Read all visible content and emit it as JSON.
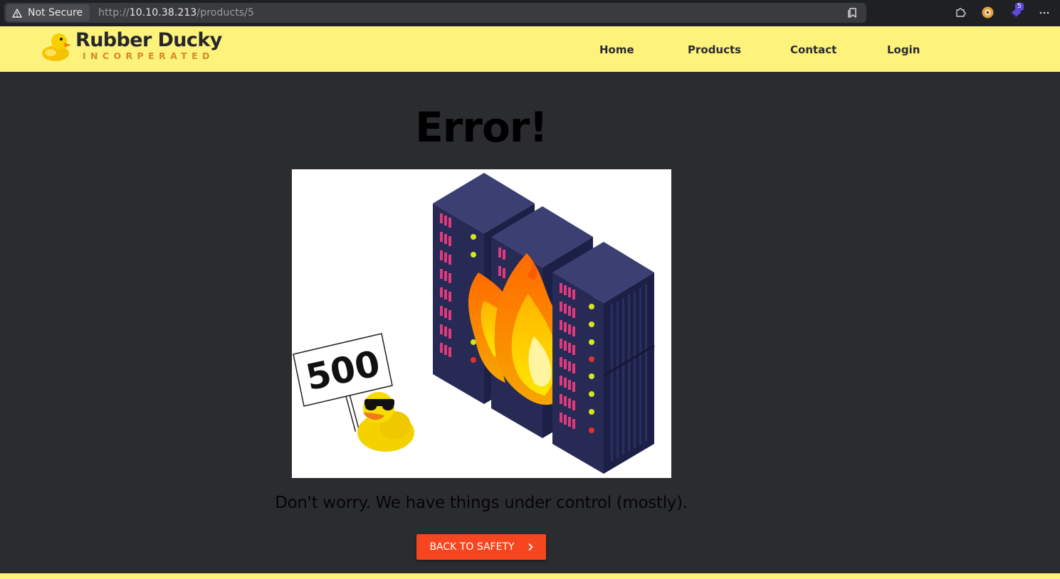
{
  "browser": {
    "security_label": "Not Secure",
    "url_scheme": "http://",
    "url_host": "10.10.38.213",
    "url_path": "/products/5",
    "extension_badge": "5",
    "icons": [
      "warning-triangle-icon",
      "reader-mode-icon",
      "extensions-puzzle-icon",
      "profile-icon",
      "extension-icon",
      "more-menu-icon"
    ]
  },
  "header": {
    "brand_name": "Rubber Ducky",
    "brand_subtitle": "INCORPERATED",
    "background_color": "#fdf27b",
    "nav": [
      {
        "label": "Home"
      },
      {
        "label": "Products"
      },
      {
        "label": "Contact"
      },
      {
        "label": "Login"
      }
    ]
  },
  "main": {
    "title": "Error!",
    "illustration": {
      "sign_text": "500",
      "icons": [
        "server-rack-icon",
        "fire-icon",
        "rubber-duck-icon"
      ]
    },
    "message": "Don't worry. We have things under control (mostly).",
    "button_label": "BACK TO SAFETY",
    "button_color": "#f5461f",
    "page_background": "#2b2c30"
  }
}
